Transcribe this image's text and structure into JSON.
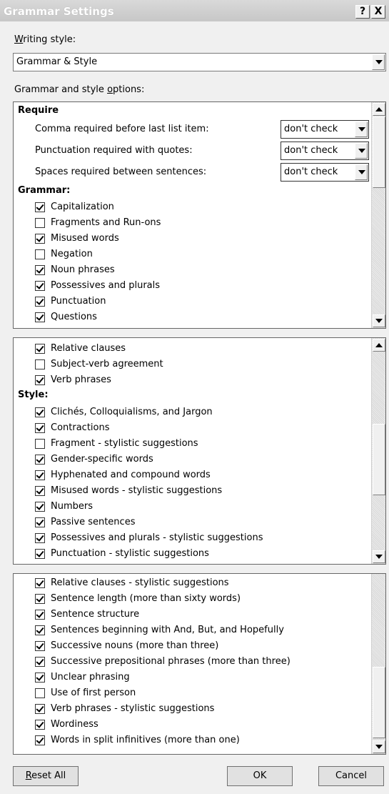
{
  "window": {
    "title": "Grammar Settings",
    "help": "?",
    "close": "X"
  },
  "writing_style": {
    "label_underlined": "W",
    "label_rest": "riting style:",
    "value": "Grammar & Style"
  },
  "options_label": {
    "before": "Grammar and style ",
    "underlined": "o",
    "after": "ptions:"
  },
  "panel1": {
    "require_heading": "Require",
    "require": [
      {
        "label": "Comma required before last list item:",
        "value": "don't check"
      },
      {
        "label": "Punctuation required with quotes:",
        "value": "don't check"
      },
      {
        "label": "Spaces required between sentences:",
        "value": "don't check"
      }
    ],
    "grammar_heading": "Grammar:",
    "items": [
      {
        "label": "Capitalization",
        "checked": true
      },
      {
        "label": "Fragments and Run-ons",
        "checked": false
      },
      {
        "label": "Misused words",
        "checked": true
      },
      {
        "label": "Negation",
        "checked": false
      },
      {
        "label": "Noun phrases",
        "checked": true
      },
      {
        "label": "Possessives and plurals",
        "checked": true
      },
      {
        "label": "Punctuation",
        "checked": true
      },
      {
        "label": "Questions",
        "checked": true
      }
    ]
  },
  "panel2": {
    "items_before": [
      {
        "label": "Relative clauses",
        "checked": true
      },
      {
        "label": "Subject-verb agreement",
        "checked": false
      },
      {
        "label": "Verb phrases",
        "checked": true
      }
    ],
    "style_heading": "Style:",
    "items_after": [
      {
        "label": "Clichés, Colloquialisms, and Jargon",
        "checked": true
      },
      {
        "label": "Contractions",
        "checked": true
      },
      {
        "label": "Fragment - stylistic suggestions",
        "checked": false
      },
      {
        "label": "Gender-specific words",
        "checked": true
      },
      {
        "label": "Hyphenated and compound words",
        "checked": true
      },
      {
        "label": "Misused words - stylistic suggestions",
        "checked": true
      },
      {
        "label": "Numbers",
        "checked": true
      },
      {
        "label": "Passive sentences",
        "checked": true
      },
      {
        "label": "Possessives and plurals - stylistic suggestions",
        "checked": true
      },
      {
        "label": "Punctuation - stylistic suggestions",
        "checked": true
      }
    ]
  },
  "panel3": {
    "items": [
      {
        "label": "Relative clauses - stylistic suggestions",
        "checked": true
      },
      {
        "label": "Sentence length (more than sixty words)",
        "checked": true
      },
      {
        "label": "Sentence structure",
        "checked": true
      },
      {
        "label": "Sentences beginning with And, But, and Hopefully",
        "checked": true
      },
      {
        "label": "Successive nouns (more than three)",
        "checked": true
      },
      {
        "label": "Successive prepositional phrases (more than three)",
        "checked": true
      },
      {
        "label": "Unclear phrasing",
        "checked": true
      },
      {
        "label": "Use of first person",
        "checked": false
      },
      {
        "label": "Verb phrases - stylistic suggestions",
        "checked": true
      },
      {
        "label": "Wordiness",
        "checked": true
      },
      {
        "label": "Words in split infinitives (more than one)",
        "checked": true
      }
    ]
  },
  "buttons": {
    "reset_underlined": "R",
    "reset_rest": "eset All",
    "ok": "OK",
    "cancel": "Cancel"
  }
}
